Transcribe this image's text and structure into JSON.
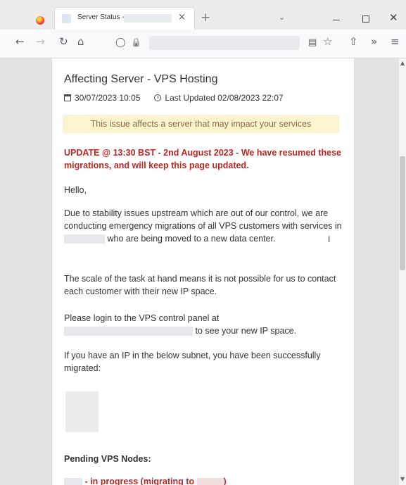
{
  "browser": {
    "tab": {
      "title": "Server Status -",
      "close": "×"
    },
    "new_tab": "+",
    "tab_list": "⌄",
    "window": {
      "close": "✕"
    },
    "nav": {
      "back": "←",
      "forward": "→",
      "reload": "↻",
      "home": "⌂",
      "tracking": "◯",
      "lock": "🔒",
      "reader": "▤",
      "bookmark": "☆",
      "pocket": "⇧",
      "more": "»",
      "menu": "≡"
    }
  },
  "page": {
    "heading": "Affecting Server - VPS Hosting",
    "date_created": "30/07/2023 10:05",
    "last_updated": "Last Updated 02/08/2023 22:07",
    "alert": "This issue affects a server that may impact your services",
    "update": "UPDATE @ 13:30 BST - 2nd August 2023 - We have resumed these migrations, and will keep this page updated.",
    "greeting": "Hello,",
    "p1_before": "Due to stability issues upstream which are out of our control, we are conducting emergency migrations of all VPS customers with services in",
    "p1_after": "who are being moved to a new data center.",
    "p2": "The scale of the task at hand means it is not possible for us to contact each customer with their new IP space.",
    "p3_before": "Please login to the VPS control panel at",
    "p3_after": "to see your new IP space.",
    "p4": "If you have an IP in the below subnet, you have been successfully migrated:",
    "pending_heading": "Pending VPS Nodes:",
    "progress_item": "- in progress (migrating to",
    "progress_close": ")"
  }
}
